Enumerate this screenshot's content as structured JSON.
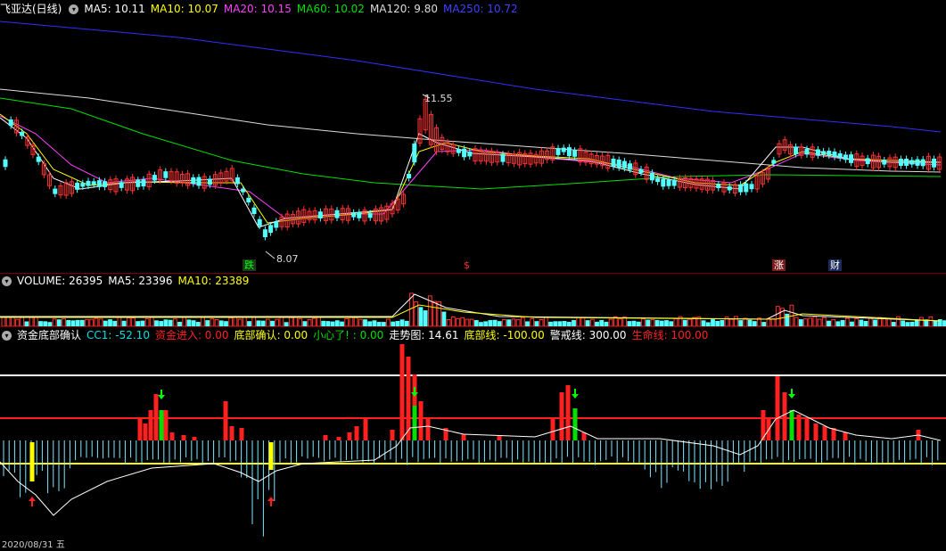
{
  "price_header": {
    "title": "飞亚达(日线)",
    "indicators": [
      {
        "label": "MA5: 10.11",
        "color": "#ffffff"
      },
      {
        "label": "MA10: 10.07",
        "color": "#ffff00"
      },
      {
        "label": "MA20: 10.15",
        "color": "#ff40ff"
      },
      {
        "label": "MA60: 10.02",
        "color": "#00e000"
      },
      {
        "label": "MA120: 9.80",
        "color": "#dddddd"
      },
      {
        "label": "MA250: 10.72",
        "color": "#4040ff"
      }
    ]
  },
  "volume_header": {
    "indicators": [
      {
        "label": "VOLUME: 26395",
        "color": "#ffffff"
      },
      {
        "label": "MA5: 23396",
        "color": "#ffffff"
      },
      {
        "label": "MA10: 23389",
        "color": "#ffff00"
      }
    ]
  },
  "indicator_header": {
    "indicators": [
      {
        "label": "资金底部确认",
        "color": "#ffffff"
      },
      {
        "label": "CC1: -52.10",
        "color": "#00e0e0"
      },
      {
        "label": "资金进入: 0.00",
        "color": "#ff2020"
      },
      {
        "label": "底部确认: 0.00",
        "color": "#ffff00"
      },
      {
        "label": "小心了! : 0.00",
        "color": "#00e000"
      },
      {
        "label": "走势图: 14.61",
        "color": "#ffffff"
      },
      {
        "label": "底部线: -100.00",
        "color": "#ffff00"
      },
      {
        "label": "警戒线: 300.00",
        "color": "#ffffff"
      },
      {
        "label": "生命线: 100.00",
        "color": "#ff2020"
      }
    ]
  },
  "price_annotations": {
    "high_label": "11.55",
    "low_label": "8.07"
  },
  "event_tags": [
    {
      "text": "跌",
      "color": "#00ff00",
      "bg": "#1a3a1a"
    },
    {
      "text": "$",
      "color": "#ff3030",
      "bg": "transparent"
    },
    {
      "text": "涨",
      "color": "#ffffff",
      "bg": "#7a1a1a"
    },
    {
      "text": "财",
      "color": "#ffffff",
      "bg": "#1a2a5a"
    }
  ],
  "colors": {
    "up": "#ff3232",
    "down": "#54ffff",
    "ma5": "#ffffff",
    "ma10": "#ffff00",
    "ma20": "#ff40ff",
    "ma60": "#00e000",
    "ma120": "#dddddd",
    "ma250": "#3030ff",
    "separator": "#7a0000"
  },
  "bottom_date": "2020/08/31 五"
}
